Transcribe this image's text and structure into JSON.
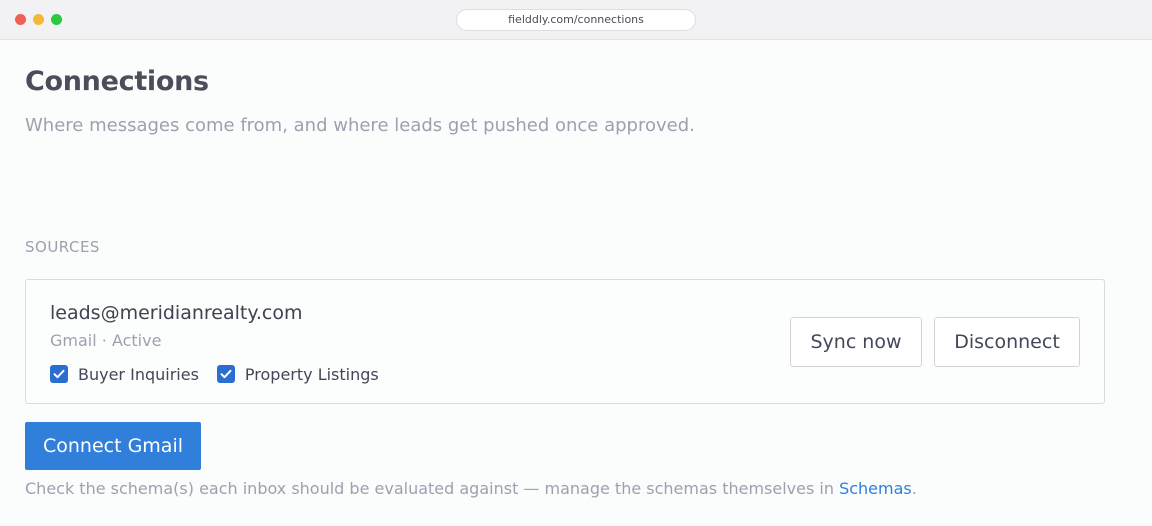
{
  "browser": {
    "url": "fielddly.com/connections"
  },
  "page": {
    "title": "Connections",
    "subtitle": "Where messages come from, and where leads get pushed once approved."
  },
  "sources": {
    "section_label": "SOURCES",
    "items": [
      {
        "email": "leads@meridianrealty.com",
        "meta": "Gmail · Active",
        "schemas": [
          {
            "label": "Buyer Inquiries",
            "checked": true
          },
          {
            "label": "Property Listings",
            "checked": true
          }
        ],
        "sync_label": "Sync now",
        "disconnect_label": "Disconnect"
      }
    ]
  },
  "connect_button_label": "Connect Gmail",
  "help": {
    "text_before": "Check the schema(s) each inbox should be evaluated against — manage the schemas themselves in ",
    "link_label": "Schemas",
    "text_after": "."
  },
  "colors": {
    "accent": "#2f7fdb",
    "checkbox": "#2a6ed1",
    "muted_text": "#9ea0b0"
  },
  "icons": [
    "checkmark-icon"
  ]
}
